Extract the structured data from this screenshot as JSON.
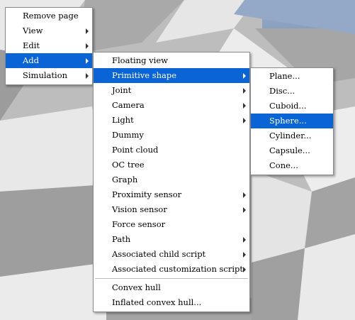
{
  "menu_level1": {
    "items": [
      {
        "label": "Remove page",
        "submenu": false
      },
      {
        "label": "View",
        "submenu": true
      },
      {
        "label": "Edit",
        "submenu": true
      },
      {
        "label": "Add",
        "submenu": true,
        "highlighted": true
      },
      {
        "label": "Simulation",
        "submenu": true
      }
    ]
  },
  "menu_add": {
    "items": [
      {
        "label": "Floating view",
        "submenu": false
      },
      {
        "label": "Primitive shape",
        "submenu": true,
        "highlighted": true
      },
      {
        "label": "Joint",
        "submenu": true
      },
      {
        "label": "Camera",
        "submenu": true
      },
      {
        "label": "Light",
        "submenu": true
      },
      {
        "label": "Dummy",
        "submenu": false
      },
      {
        "label": "Point cloud",
        "submenu": false
      },
      {
        "label": "OC tree",
        "submenu": false
      },
      {
        "label": "Graph",
        "submenu": false
      },
      {
        "label": "Proximity sensor",
        "submenu": true
      },
      {
        "label": "Vision sensor",
        "submenu": true
      },
      {
        "label": "Force sensor",
        "submenu": false
      },
      {
        "label": "Path",
        "submenu": true
      },
      {
        "label": "Associated child script",
        "submenu": true
      },
      {
        "label": "Associated customization script",
        "submenu": true
      }
    ],
    "items_after_separator": [
      {
        "label": "Convex hull",
        "submenu": false
      },
      {
        "label": "Inflated convex hull...",
        "submenu": false
      }
    ]
  },
  "menu_primitive": {
    "items": [
      {
        "label": "Plane...",
        "submenu": false
      },
      {
        "label": "Disc...",
        "submenu": false
      },
      {
        "label": "Cuboid...",
        "submenu": false
      },
      {
        "label": "Sphere...",
        "submenu": false,
        "highlighted": true
      },
      {
        "label": "Cylinder...",
        "submenu": false
      },
      {
        "label": "Capsule...",
        "submenu": false
      },
      {
        "label": "Cone...",
        "submenu": false
      }
    ]
  },
  "colors": {
    "highlight": "#0a64d6",
    "menu_bg": "#ffffff",
    "sky": "#8fa6c4",
    "floor_light": "#ececec",
    "floor_dark": "#a8a8a8"
  }
}
